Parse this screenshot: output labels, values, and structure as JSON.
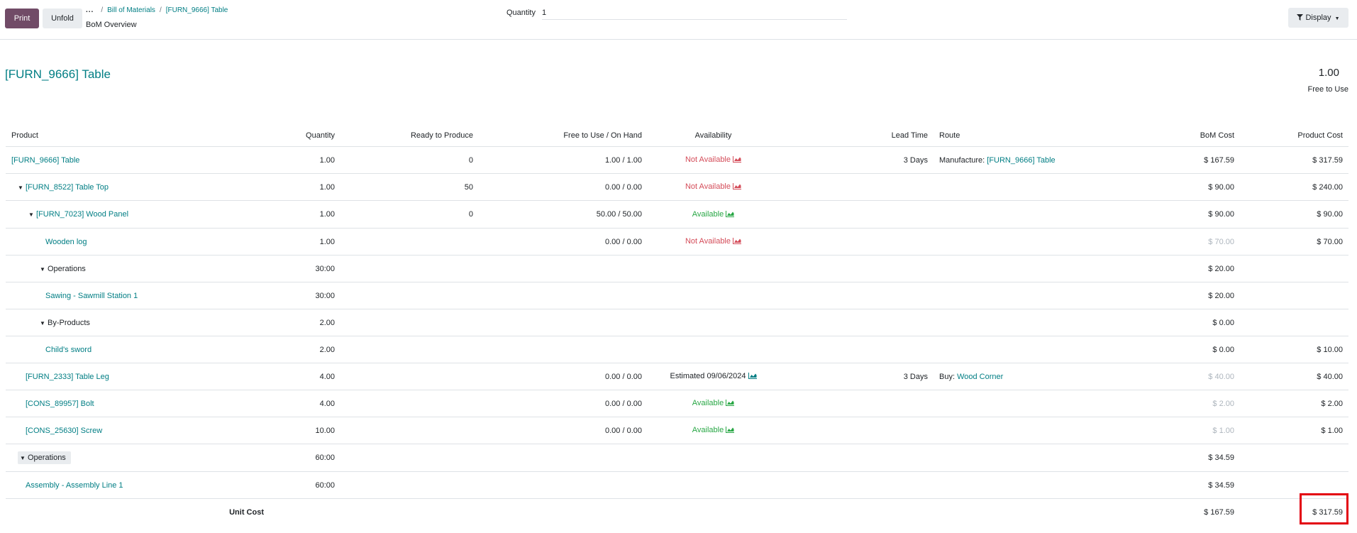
{
  "control_panel": {
    "print_label": "Print",
    "unfold_label": "Unfold",
    "breadcrumb_dots": "...",
    "breadcrumbs": [
      "Bill of Materials",
      "[FURN_9666] Table"
    ],
    "page_subtitle": "BoM Overview",
    "quantity_label": "Quantity",
    "quantity_value": "1",
    "display_label": "Display"
  },
  "report": {
    "title": "[FURN_9666] Table",
    "summary_qty": "1.00",
    "summary_label": "Free to Use"
  },
  "columns": [
    "Product",
    "Quantity",
    "Ready to Produce",
    "Free to Use / On Hand",
    "Availability",
    "Lead Time",
    "Route",
    "BoM Cost",
    "Product Cost"
  ],
  "rows": [
    {
      "product": "[FURN_9666] Table",
      "qty": "1.00",
      "ready": "0",
      "free": "1.00 / 1.00",
      "avail": "Not Available",
      "lead": "3 Days",
      "route_prefix": "Manufacture: ",
      "route_link": "[FURN_9666] Table",
      "bom": "$ 167.59",
      "prod": "$ 317.59"
    },
    {
      "product": "[FURN_8522] Table Top",
      "qty": "1.00",
      "ready": "50",
      "free": "0.00 / 0.00",
      "avail": "Not Available",
      "lead": "",
      "route_prefix": "",
      "route_link": "",
      "bom": "$ 90.00",
      "prod": "$ 240.00"
    },
    {
      "product": "[FURN_7023] Wood Panel",
      "qty": "1.00",
      "ready": "0",
      "free": "50.00 / 50.00",
      "avail": "Available",
      "lead": "",
      "route_prefix": "",
      "route_link": "",
      "bom": "$ 90.00",
      "prod": "$ 90.00"
    },
    {
      "product": "Wooden log",
      "qty": "1.00",
      "ready": "",
      "free": "0.00 / 0.00",
      "avail": "Not Available",
      "lead": "",
      "route_prefix": "",
      "route_link": "",
      "bom": "$ 70.00",
      "prod": "$ 70.00"
    },
    {
      "product": "Operations",
      "qty": "30:00",
      "ready": "",
      "free": "",
      "avail": "",
      "lead": "",
      "route_prefix": "",
      "route_link": "",
      "bom": "$ 20.00",
      "prod": ""
    },
    {
      "product": "Sawing - Sawmill Station 1",
      "qty": "30:00",
      "ready": "",
      "free": "",
      "avail": "",
      "lead": "",
      "route_prefix": "",
      "route_link": "",
      "bom": "$ 20.00",
      "prod": ""
    },
    {
      "product": "By-Products",
      "qty": "2.00",
      "ready": "",
      "free": "",
      "avail": "",
      "lead": "",
      "route_prefix": "",
      "route_link": "",
      "bom": "$ 0.00",
      "prod": ""
    },
    {
      "product": "Child's sword",
      "qty": "2.00",
      "ready": "",
      "free": "",
      "avail": "",
      "lead": "",
      "route_prefix": "",
      "route_link": "",
      "bom": "$ 0.00",
      "prod": "$ 10.00"
    },
    {
      "product": "[FURN_2333] Table Leg",
      "qty": "4.00",
      "ready": "",
      "free": "0.00 / 0.00",
      "avail": "Estimated 09/06/2024",
      "lead": "3 Days",
      "route_prefix": "Buy: ",
      "route_link": "Wood Corner",
      "bom": "$ 40.00",
      "prod": "$ 40.00"
    },
    {
      "product": "[CONS_89957] Bolt",
      "qty": "4.00",
      "ready": "",
      "free": "0.00 / 0.00",
      "avail": "Available",
      "lead": "",
      "route_prefix": "",
      "route_link": "",
      "bom": "$ 2.00",
      "prod": "$ 2.00"
    },
    {
      "product": "[CONS_25630] Screw",
      "qty": "10.00",
      "ready": "",
      "free": "0.00 / 0.00",
      "avail": "Available",
      "lead": "",
      "route_prefix": "",
      "route_link": "",
      "bom": "$ 1.00",
      "prod": "$ 1.00"
    },
    {
      "product": "Operations",
      "qty": "60:00",
      "ready": "",
      "free": "",
      "avail": "",
      "lead": "",
      "route_prefix": "",
      "route_link": "",
      "bom": "$ 34.59",
      "prod": ""
    },
    {
      "product": "Assembly - Assembly Line 1",
      "qty": "60:00",
      "ready": "",
      "free": "",
      "avail": "",
      "lead": "",
      "route_prefix": "",
      "route_link": "",
      "bom": "$ 34.59",
      "prod": ""
    }
  ],
  "total": {
    "label": "Unit Cost",
    "bom": "$ 167.59",
    "prod": "$ 317.59"
  },
  "colors": {
    "primary": "#714B67",
    "link": "#017e84",
    "not_available": "#d44c59",
    "available": "#28a745",
    "muted": "#adb5bd",
    "highlight": "#e3000f"
  },
  "icons": {
    "caret": "caret-down-icon",
    "forecast": "area-chart-icon",
    "filter": "filter-icon"
  }
}
